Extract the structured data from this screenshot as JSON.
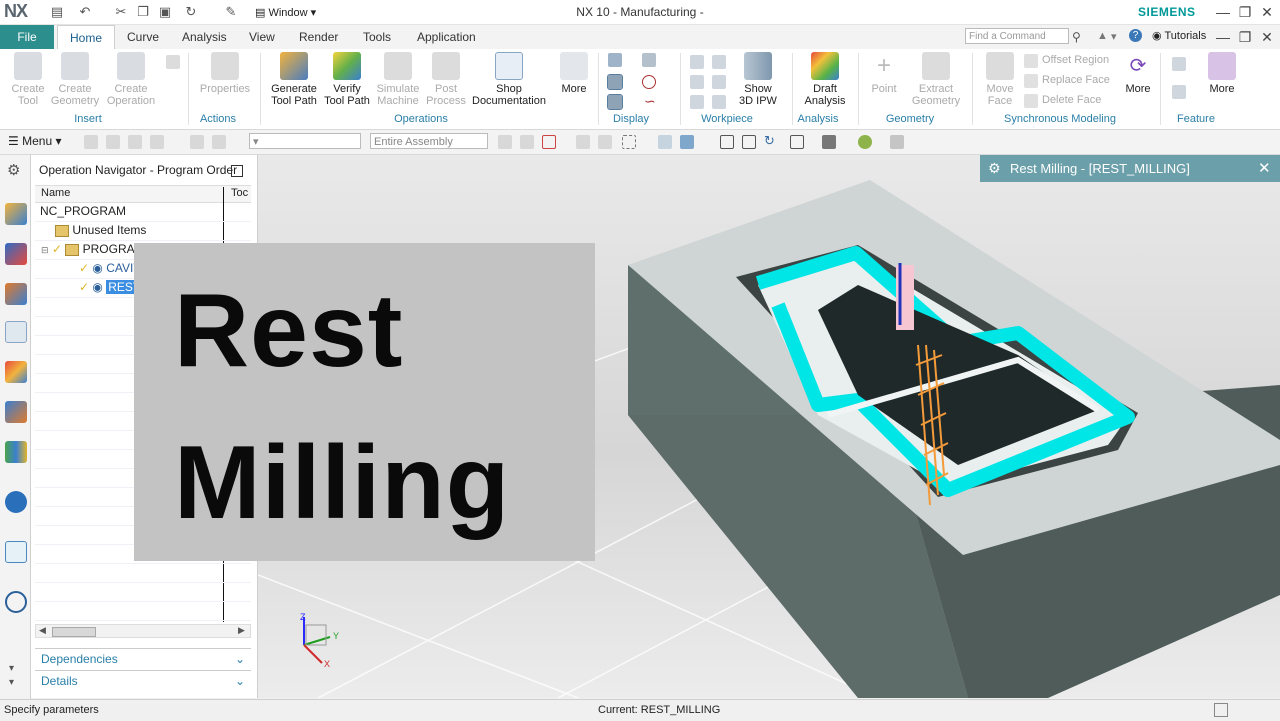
{
  "app": {
    "logo": "NX",
    "title": "NX 10 - Manufacturing -",
    "brand": "SIEMENS",
    "window_menu": "Window"
  },
  "tabs": {
    "file": "File",
    "items": [
      "Home",
      "Curve",
      "Analysis",
      "View",
      "Render",
      "Tools",
      "Application"
    ],
    "active": "Home",
    "search_placeholder": "Find a Command",
    "tutorials": "Tutorials"
  },
  "ribbon": {
    "insert": {
      "label": "Insert",
      "create_tool": "Create\nTool",
      "create_geometry": "Create\nGeometry",
      "create_operation": "Create\nOperation"
    },
    "actions": {
      "label": "Actions",
      "properties": "Properties"
    },
    "operations": {
      "label": "Operations",
      "generate": "Generate\nTool Path",
      "verify": "Verify\nTool Path",
      "simulate": "Simulate\nMachine",
      "post": "Post\nProcess",
      "shop": "Shop\nDocumentation",
      "more": "More"
    },
    "display": {
      "label": "Display"
    },
    "workpiece": {
      "label": "Workpiece",
      "show_ipw": "Show\n3D IPW"
    },
    "analysis": {
      "label": "Analysis",
      "draft": "Draft\nAnalysis"
    },
    "geometry": {
      "label": "Geometry",
      "point": "Point",
      "extract": "Extract\nGeometry"
    },
    "sync": {
      "label": "Synchronous Modeling",
      "move_face": "Move\nFace",
      "offset_region": "Offset Region",
      "replace_face": "Replace Face",
      "delete_face": "Delete Face",
      "more": "More"
    },
    "feature": {
      "label": "Feature",
      "more": "More"
    }
  },
  "toolbar": {
    "menu": "Menu",
    "assembly_combo": "Entire Assembly"
  },
  "navigator": {
    "title": "Operation Navigator - Program Order",
    "col_name": "Name",
    "col_tool": "Toc",
    "rows": [
      "NC_PROGRAM",
      "Unused Items",
      "PROGRAM",
      "CAVITY_MILL",
      "REST_MILLING"
    ],
    "dependencies": "Dependencies",
    "details": "Details"
  },
  "dialog": {
    "title": "Rest Milling - [REST_MILLING]"
  },
  "overlay": {
    "line1": "Rest",
    "line2": "Milling"
  },
  "triad": {
    "z": "Z",
    "y": "Y",
    "x": "X"
  },
  "status": {
    "left": "Specify parameters",
    "center": "Current: REST_MILLING"
  },
  "colors": {
    "accent": "#2d8f8d",
    "group_label": "#2a7fa8",
    "brand": "#009999",
    "toolpath": "#00e5e5"
  }
}
